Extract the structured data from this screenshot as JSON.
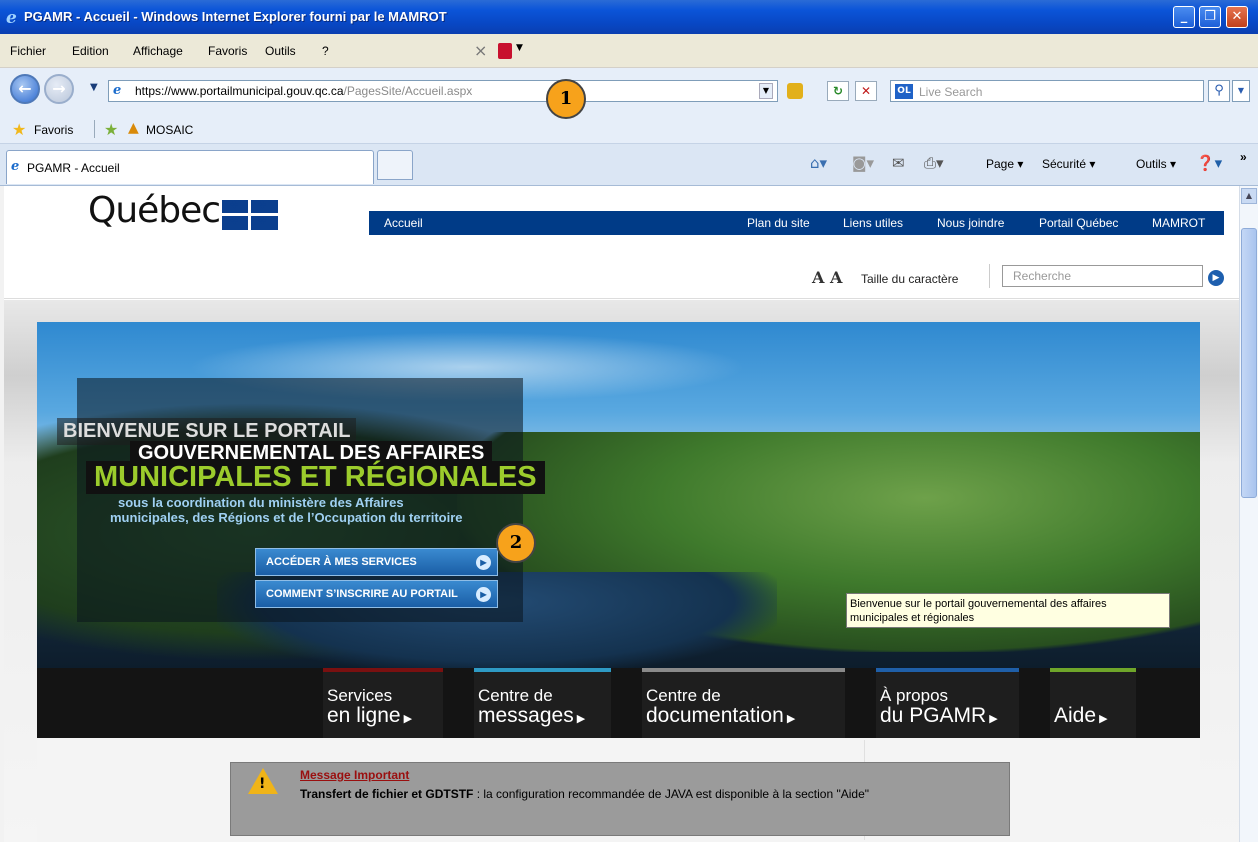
{
  "window": {
    "title": "PGAMR - Accueil - Windows Internet Explorer fourni par le MAMROT",
    "buttons": {
      "minimize": "_",
      "maximize": "❐",
      "close": "✕"
    }
  },
  "menu": {
    "items": [
      "Fichier",
      "Edition",
      "Affichage",
      "Favoris",
      "Outils",
      "?"
    ]
  },
  "address": {
    "url_bold": "https://www.portailmunicipal.gouv.qc.ca",
    "url_dim": "/PagesSite/Accueil.aspx",
    "search_placeholder": "Live Search"
  },
  "favorites": {
    "label": "Favoris",
    "items": [
      "MOSAIC"
    ]
  },
  "tabs": {
    "active": "PGAMR - Accueil",
    "commands": {
      "page": "Page ▾",
      "securite": "Sécurité ▾",
      "outils": "Outils ▾"
    }
  },
  "site": {
    "logo": "Québec",
    "topnav": {
      "accueil": "Accueil",
      "plan": "Plan du site",
      "liens": "Liens utiles",
      "joindre": "Nous joindre",
      "portail": "Portail Québec",
      "mamrot": "MAMROT"
    },
    "font_size_icon": "A A",
    "font_size_label": "Taille du caractère",
    "search_placeholder": "Recherche"
  },
  "hero": {
    "line1": "BIENVENUE SUR LE PORTAIL",
    "line2": "GOUVERNEMENTAL DES AFFAIRES",
    "line3": "MUNICIPALES ET RÉGIONALES",
    "line4a": "sous la coordination du ministère des Affaires",
    "line4b": "municipales, des Régions et de l’Occupation du territoire",
    "btn_services": "ACCÉDER À MES SERVICES",
    "btn_inscrire": "COMMENT S’INSCRIRE AU PORTAIL",
    "tooltip": "Bienvenue sur le portail gouvernemental des affaires municipales et régionales"
  },
  "callouts": {
    "one": "1",
    "two": "2"
  },
  "hero_nav": [
    {
      "l1": "Services",
      "l2": "en ligne",
      "color": "#7a1010"
    },
    {
      "l1": "Centre de",
      "l2": "messages",
      "color": "#2e9ac4"
    },
    {
      "l1": "Centre de",
      "l2": "documentation",
      "color": "#8a8a8a"
    },
    {
      "l1": "À propos",
      "l2": "du PGAMR",
      "color": "#1f5fa8"
    },
    {
      "l1": "",
      "l2": "Aide",
      "color": "#6fa62a"
    }
  ],
  "message": {
    "title": "Message Important",
    "bold": "Transfert de fichier et GDTSTF",
    "body": " : la configuration recommandée de JAVA est disponible à la section \"Aide\""
  }
}
